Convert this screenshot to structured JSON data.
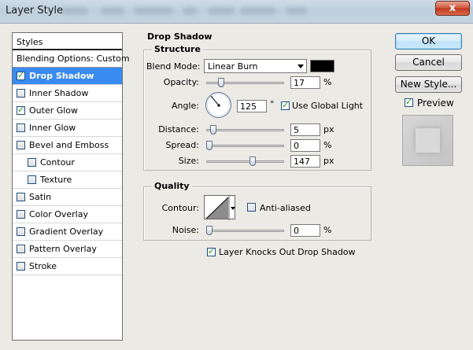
{
  "window": {
    "title": "Layer Style",
    "close_glyph": "x"
  },
  "styles_panel": {
    "header": "Styles",
    "blending_options": "Blending Options: Custom",
    "items": [
      {
        "label": "Drop Shadow",
        "checked": true,
        "selected": true
      },
      {
        "label": "Inner Shadow",
        "checked": false
      },
      {
        "label": "Outer Glow",
        "checked": true
      },
      {
        "label": "Inner Glow",
        "checked": false
      },
      {
        "label": "Bevel and Emboss",
        "checked": false
      },
      {
        "label": "Contour",
        "checked": false,
        "indent": true
      },
      {
        "label": "Texture",
        "checked": false,
        "indent": true
      },
      {
        "label": "Satin",
        "checked": false
      },
      {
        "label": "Color Overlay",
        "checked": false
      },
      {
        "label": "Gradient Overlay",
        "checked": false
      },
      {
        "label": "Pattern Overlay",
        "checked": false
      },
      {
        "label": "Stroke",
        "checked": false
      }
    ]
  },
  "drop_shadow": {
    "title": "Drop Shadow",
    "structure": {
      "title": "Structure",
      "blend_mode_label": "Blend Mode:",
      "blend_mode_value": "Linear Burn",
      "shadow_color": "#000000",
      "opacity_label": "Opacity:",
      "opacity_value": "17",
      "opacity_unit": "%",
      "angle_label": "Angle:",
      "angle_value": "125",
      "angle_unit": "°",
      "use_global_light_label": "Use Global Light",
      "use_global_light_checked": true,
      "distance_label": "Distance:",
      "distance_value": "5",
      "distance_unit": "px",
      "spread_label": "Spread:",
      "spread_value": "0",
      "spread_unit": "%",
      "size_label": "Size:",
      "size_value": "147",
      "size_unit": "px"
    },
    "quality": {
      "title": "Quality",
      "contour_label": "Contour:",
      "anti_aliased_label": "Anti-aliased",
      "anti_aliased_checked": false,
      "noise_label": "Noise:",
      "noise_value": "0",
      "noise_unit": "%"
    },
    "layer_knocks_out_label": "Layer Knocks Out Drop Shadow",
    "layer_knocks_out_checked": true
  },
  "buttons": {
    "ok": "OK",
    "cancel": "Cancel",
    "new_style": "New Style...",
    "preview_label": "Preview",
    "preview_checked": true
  },
  "slider_levels": {
    "opacity": 0.17,
    "distance": 0.05,
    "spread": 0.0,
    "size": 0.6,
    "noise": 0.0
  }
}
